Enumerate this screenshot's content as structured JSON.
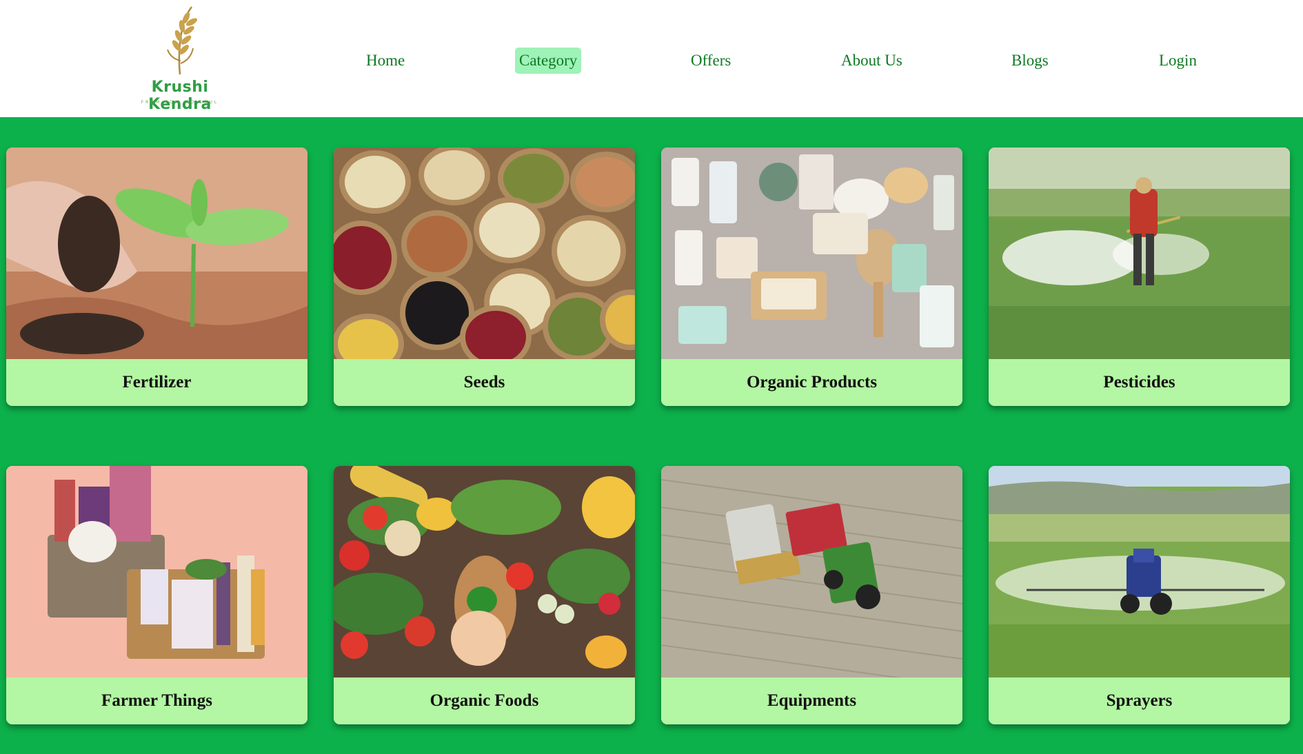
{
  "header": {
    "logo": {
      "name": "Krushi Kendra",
      "tagline": "FROM SOIL TO SOUL"
    },
    "nav": [
      {
        "label": "Home",
        "active": false
      },
      {
        "label": "Category",
        "active": true
      },
      {
        "label": "Offers",
        "active": false
      },
      {
        "label": "About Us",
        "active": false
      },
      {
        "label": "Blogs",
        "active": false
      },
      {
        "label": "Login",
        "active": false
      }
    ]
  },
  "categories": [
    {
      "label": "Fertilizer",
      "image": "fertilizer-image"
    },
    {
      "label": "Seeds",
      "image": "seeds-image"
    },
    {
      "label": "Organic Products",
      "image": "organic-products-image"
    },
    {
      "label": "Pesticides",
      "image": "pesticides-image"
    },
    {
      "label": "Farmer Things",
      "image": "farmer-things-image"
    },
    {
      "label": "Organic Foods",
      "image": "organic-foods-image"
    },
    {
      "label": "Equipments",
      "image": "equipments-image"
    },
    {
      "label": "Sprayers",
      "image": "sprayers-image"
    }
  ],
  "colors": {
    "page_background": "#0db14b",
    "header_background": "#ffffff",
    "nav_text": "#0e7a23",
    "nav_active_background": "#9ff2b8",
    "card_label_background": "#b3f6a3"
  }
}
